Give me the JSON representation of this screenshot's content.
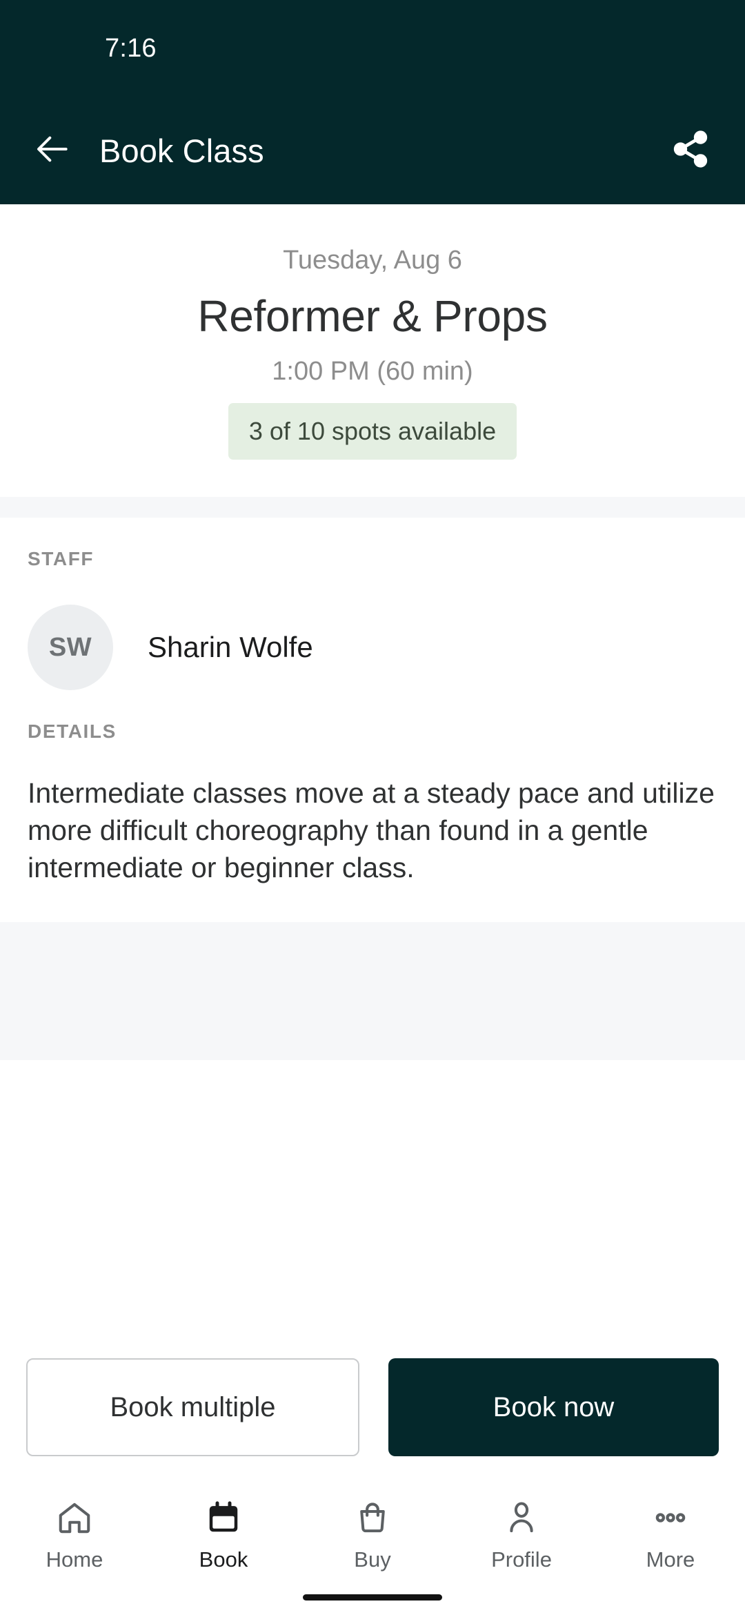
{
  "status_bar": {
    "time": "7:16"
  },
  "app_bar": {
    "title": "Book Class",
    "back_icon": "arrow-left-icon",
    "share_icon": "share-icon"
  },
  "class_header": {
    "date": "Tuesday, Aug 6",
    "name": "Reformer & Props",
    "time": "1:00 PM (60 min)",
    "spots": "3 of 10 spots available",
    "spots_available": 3,
    "spots_total": 10
  },
  "staff_section": {
    "label": "STAFF",
    "initials": "SW",
    "name": "Sharin Wolfe"
  },
  "details_section": {
    "label": "DETAILS",
    "text": "Intermediate classes move at a steady pace and utilize more difficult choreography than found in a gentle intermediate or beginner class."
  },
  "actions": {
    "secondary_label": "Book multiple",
    "primary_label": "Book now"
  },
  "bottom_nav": {
    "items": [
      {
        "label": "Home",
        "icon": "home-icon",
        "active": false
      },
      {
        "label": "Book",
        "icon": "calendar-icon",
        "active": true
      },
      {
        "label": "Buy",
        "icon": "bag-icon",
        "active": false
      },
      {
        "label": "Profile",
        "icon": "person-icon",
        "active": false
      },
      {
        "label": "More",
        "icon": "more-dots-icon",
        "active": false
      }
    ]
  },
  "colors": {
    "brand_dark_teal": "#04282b",
    "chip_green_bg": "#e4efe2",
    "chip_green_text": "#3d4a3c",
    "muted_gray": "#8d8d8d",
    "surface_gray": "#f6f7f9"
  }
}
